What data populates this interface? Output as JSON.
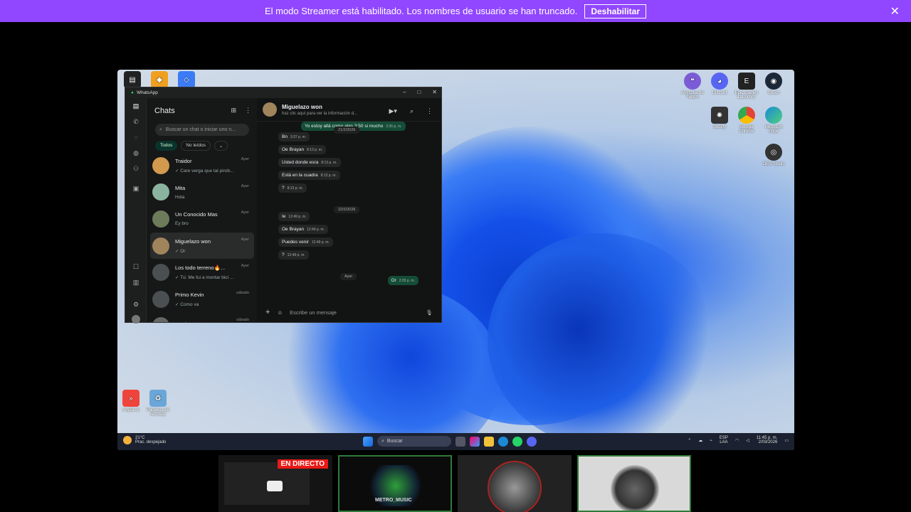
{
  "banner": {
    "message": "El modo Streamer está habilitado. Los nombres de usuario se han truncado.",
    "button": "Deshabilitar",
    "close": "✕"
  },
  "desktop_icons": [
    {
      "label": "Anyzona de Twitch",
      "color": "#7b5cd6"
    },
    {
      "label": "Discord",
      "color": "#5865f2"
    },
    {
      "label": "Epic Games Launcher",
      "color": "#222"
    },
    {
      "label": "Steam",
      "color": "#1b2838"
    },
    {
      "label": "Spotify",
      "color": "#333"
    },
    {
      "label": "Google Chrome",
      "color": "#e54335"
    },
    {
      "label": "Microsoft Edge",
      "color": "#1b8ad6"
    },
    {
      "label": "OBS Studio",
      "color": "#333"
    },
    {
      "label": "AnyDesk",
      "color": "#ef443b"
    },
    {
      "label": "Papelera de reciclaje",
      "color": "#6aa6d8"
    }
  ],
  "whatsapp": {
    "title": "WhatsApp",
    "window_controls": [
      "–",
      "□",
      "✕"
    ],
    "list_title": "Chats",
    "search_placeholder": "Buscar un chat o iniciar uno n...",
    "filters": [
      "Todos",
      "No leídos",
      "⌄"
    ],
    "chats": [
      {
        "name": "Traidor",
        "preview": "✓ Care verga que tal pirob...",
        "time": "Ayer",
        "color": "#d19a4e"
      },
      {
        "name": "Mita",
        "preview": "Hola",
        "time": "Ayer",
        "color": "#8ab4a0"
      },
      {
        "name": "Un Conocido Mas",
        "preview": "Ey bro",
        "time": "Ayer",
        "color": "#6e7b5a"
      },
      {
        "name": "Miguelazo won",
        "preview": "✓ Or",
        "time": "Ayer",
        "color": "#a0845c"
      },
      {
        "name": "Los todo terreno🔥...",
        "preview": "✓ Tú: Me fui a montar bici ...",
        "time": "Ayer",
        "color": "#4a4f52"
      },
      {
        "name": "Primo Kevin",
        "preview": "✓ Como va",
        "time": "sábado",
        "color": "#4a4f52"
      },
      {
        "name": "Los bros",
        "preview": "",
        "time": "sábado",
        "color": "#666"
      }
    ],
    "conversation": {
      "name": "Miguelazo won",
      "subtitle": "haz clic aquí para ver la información d...",
      "top_message": "Yo estoy allá como alas 3:50 si mucho",
      "top_time": "3:36 p. m.",
      "day1": "21/2/2026",
      "day2": "22/2/2026",
      "day3": "Ayer",
      "messages": [
        {
          "text": "Bn",
          "time": "3:37 p. m.",
          "dir": "in"
        },
        {
          "text": "Oe Brayan",
          "time": "8:13 p. m.",
          "dir": "in"
        },
        {
          "text": "Usted donde esra",
          "time": "8:13 p. m.",
          "dir": "in"
        },
        {
          "text": "Está en la cuadra",
          "time": "8:13 p. m.",
          "dir": "in"
        },
        {
          "text": "?",
          "time": "8:13 p. m.",
          "dir": "in"
        },
        {
          "text": "Ie",
          "time": "12:49 p. m.",
          "dir": "in"
        },
        {
          "text": "Oe Brayan",
          "time": "12:49 p. m.",
          "dir": "in"
        },
        {
          "text": "Puedes venir",
          "time": "12:49 p. m.",
          "dir": "in"
        },
        {
          "text": "?",
          "time": "12:49 p. m.",
          "dir": "in"
        },
        {
          "text": "Or",
          "time": "2:05 p. m.",
          "dir": "out"
        }
      ],
      "composer_placeholder": "Escribe un mensaje"
    }
  },
  "taskbar": {
    "weather_temp": "21°C",
    "weather_desc": "Prac. despejado",
    "search": "Buscar",
    "lang": "ESP",
    "lang2": "LAA",
    "time": "11:45 p. m.",
    "date": "2/03/2026"
  },
  "thumbnails": {
    "live_label": "EN DIRECTO",
    "metro_label": "METRO_MUSIC"
  }
}
